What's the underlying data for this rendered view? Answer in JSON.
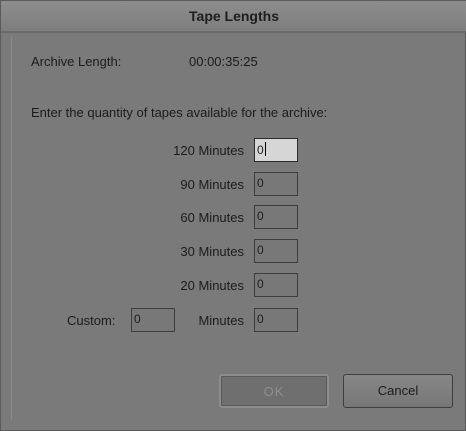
{
  "dialog": {
    "title": "Tape Lengths",
    "archive_length_label": "Archive Length:",
    "archive_length_value": "00:00:35:25",
    "instruction": "Enter the quantity of tapes available for the archive:",
    "rows": [
      {
        "label": "120 Minutes",
        "value": "0"
      },
      {
        "label": "90 Minutes",
        "value": "0"
      },
      {
        "label": "60 Minutes",
        "value": "0"
      },
      {
        "label": "30 Minutes",
        "value": "0"
      },
      {
        "label": "20 Minutes",
        "value": "0"
      }
    ],
    "custom": {
      "label": "Custom:",
      "minutes_value": "0",
      "minutes_label": "Minutes",
      "quantity_value": "0"
    },
    "ok_label": "OK",
    "cancel_label": "Cancel"
  }
}
